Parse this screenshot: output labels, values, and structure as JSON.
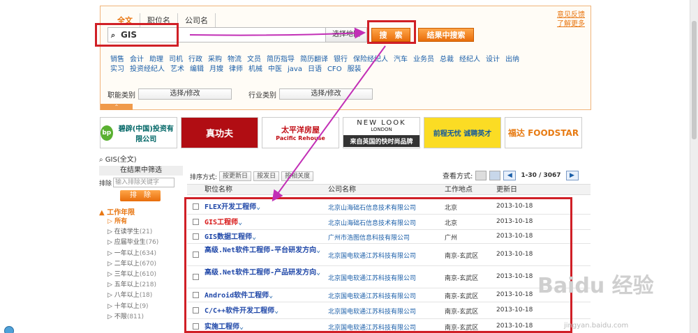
{
  "search": {
    "tabs": [
      "全文",
      "职位名",
      "公司名"
    ],
    "query": "GIS",
    "area_button": "选择地区",
    "search_button": "搜　索",
    "result_search_button": "结果中搜索",
    "side_links": [
      "意见反馈",
      "了解更多"
    ]
  },
  "keywords": [
    "销售",
    "会计",
    "助理",
    "司机",
    "行政",
    "采购",
    "物流",
    "文员",
    "简历指导",
    "简历翻译",
    "银行",
    "保险经纪人",
    "汽车",
    "业务员",
    "总裁",
    "经纪人",
    "设计",
    "出纳",
    "实习",
    "投资经纪人",
    "艺术",
    "编辑",
    "月嫂",
    "律师",
    "机械",
    "中医",
    "java",
    "日语",
    "CFO",
    "服装"
  ],
  "category": {
    "job_label": "职能类别",
    "job_select": "选择/修改",
    "industry_label": "行业类别",
    "industry_select": "选择/修改",
    "collapse": "⌃"
  },
  "ads": {
    "bp": {
      "circle": "bp",
      "text": "碧辟(中国)投资有限公司"
    },
    "kungfu": "真功夫",
    "pacific": {
      "cn": "太平洋房屋",
      "en": "Pacific Rehouse"
    },
    "newlook": {
      "title": "NEW LOOK",
      "sub": "LONDON",
      "bar": "来自英国的快时尚品牌"
    },
    "job51": "前程无忧 诚聘英才",
    "foodstar": "福达 FOODSTAR"
  },
  "filter": {
    "query_label": "GIS(全文)",
    "header": "在结果中筛选",
    "exclude_label": "排除",
    "exclude_placeholder": "输入排除关键字",
    "exclude_button": "排　除",
    "section_title": "工作年限",
    "items": [
      {
        "label": "所有",
        "count": ""
      },
      {
        "label": "在读学生",
        "count": "(21)"
      },
      {
        "label": "应届毕业生",
        "count": "(76)"
      },
      {
        "label": "一年以上",
        "count": "(634)"
      },
      {
        "label": "二年以上",
        "count": "(670)"
      },
      {
        "label": "三年以上",
        "count": "(610)"
      },
      {
        "label": "五年以上",
        "count": "(218)"
      },
      {
        "label": "八年以上",
        "count": "(18)"
      },
      {
        "label": "十年以上",
        "count": "(9)"
      },
      {
        "label": "不限",
        "count": "(811)"
      }
    ]
  },
  "sort": {
    "label": "排序方式:",
    "buttons": [
      "按更新日",
      "按发日",
      "按相关度"
    ],
    "view_label": "查看方式:",
    "pager": "1-30 / 3067"
  },
  "table": {
    "headers": [
      "职位名称",
      "公司名称",
      "工作地点",
      "更新日"
    ],
    "rows": [
      {
        "title": "FLEX开发工程师",
        "company": "北京山海础石信息技术有限公司",
        "location": "北京",
        "date": "2013-10-18",
        "red": false
      },
      {
        "title": "GIS工程师",
        "company": "北京山海础石信息技术有限公司",
        "location": "北京",
        "date": "2013-10-18",
        "red": true
      },
      {
        "title": "GIS数据工程师",
        "company": "广州市浩图信息科技有限公司",
        "location": "广州",
        "date": "2013-10-18",
        "red": false
      },
      {
        "title": "高级.Net软件工程师-平台研发方向",
        "company": "北京国电软通江苏科技有限公司",
        "location": "南京-玄武区",
        "date": "2013-10-18",
        "red": false
      },
      {
        "title": "高级.Net软件工程师-产品研发方向",
        "company": "北京国电软通江苏科技有限公司",
        "location": "南京-玄武区",
        "date": "2013-10-18",
        "red": false
      },
      {
        "title": "Android软件工程师",
        "company": "北京国电软通江苏科技有限公司",
        "location": "南京-玄武区",
        "date": "2013-10-18",
        "red": false
      },
      {
        "title": "C/C++软件开发工程师",
        "company": "北京国电软通江苏科技有限公司",
        "location": "南京-玄武区",
        "date": "2013-10-18",
        "red": false
      },
      {
        "title": "实施工程师",
        "company": "北京国电软通江苏科技有限公司",
        "location": "南京-玄武区",
        "date": "2013-10-18",
        "red": false
      }
    ]
  },
  "watermark": {
    "brand": "Baidu 经验",
    "url": "jingyan.baidu.com"
  }
}
